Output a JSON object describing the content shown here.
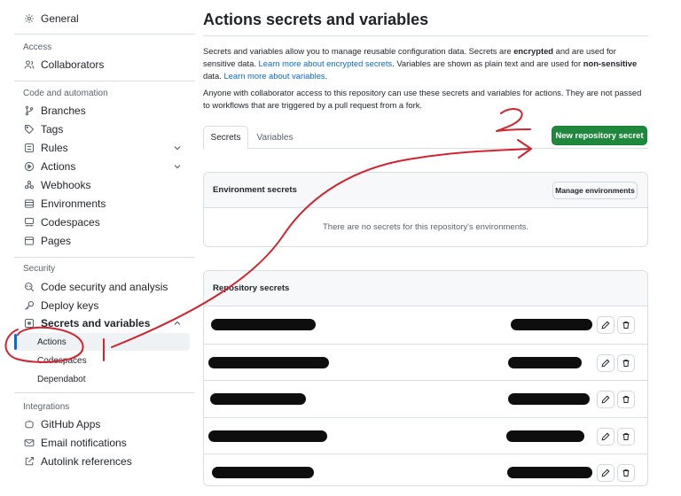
{
  "sidebar": {
    "general": "General",
    "sections": {
      "access": "Access",
      "code_automation": "Code and automation",
      "security": "Security",
      "integrations": "Integrations"
    },
    "items": {
      "collaborators": "Collaborators",
      "branches": "Branches",
      "tags": "Tags",
      "rules": "Rules",
      "actions": "Actions",
      "webhooks": "Webhooks",
      "environments": "Environments",
      "codespaces": "Codespaces",
      "pages": "Pages",
      "code_security": "Code security and analysis",
      "deploy_keys": "Deploy keys",
      "secrets_variables": "Secrets and variables",
      "sub_actions": "Actions",
      "sub_codespaces": "Codespaces",
      "sub_dependabot": "Dependabot",
      "github_apps": "GitHub Apps",
      "email_notifications": "Email notifications",
      "autolink": "Autolink references"
    }
  },
  "main": {
    "title": "Actions secrets and variables",
    "intro": {
      "p1_a": "Secrets and variables allow you to manage reusable configuration data. Secrets are ",
      "p1_encrypted": "encrypted",
      "p1_b": " and are used for sensitive data. ",
      "p1_link1": "Learn more about encrypted secrets",
      "p1_c": ". Variables are shown as plain text and are used for ",
      "p1_nonsensitive": "non-sensitive",
      "p1_d": " data. ",
      "p1_link2": "Learn more about variables",
      "p1_e": ".",
      "p2": "Anyone with collaborator access to this repository can use these secrets and variables for actions. They are not passed to workflows that are triggered by a pull request from a fork."
    },
    "tabs": [
      "Secrets",
      "Variables"
    ],
    "new_secret_button": "New repository secret",
    "env_secrets": {
      "title": "Environment secrets",
      "manage_button": "Manage environments",
      "empty": "There are no secrets for this repository's environments."
    },
    "repo_secrets": {
      "title": "Repository secrets",
      "row_count": 5
    }
  },
  "annotations": {
    "step1": "1",
    "step2": "2",
    "color": "#d1242f"
  },
  "colors": {
    "primary_button": "#1f883d",
    "link": "#0969da",
    "active_indicator": "#0969da"
  }
}
